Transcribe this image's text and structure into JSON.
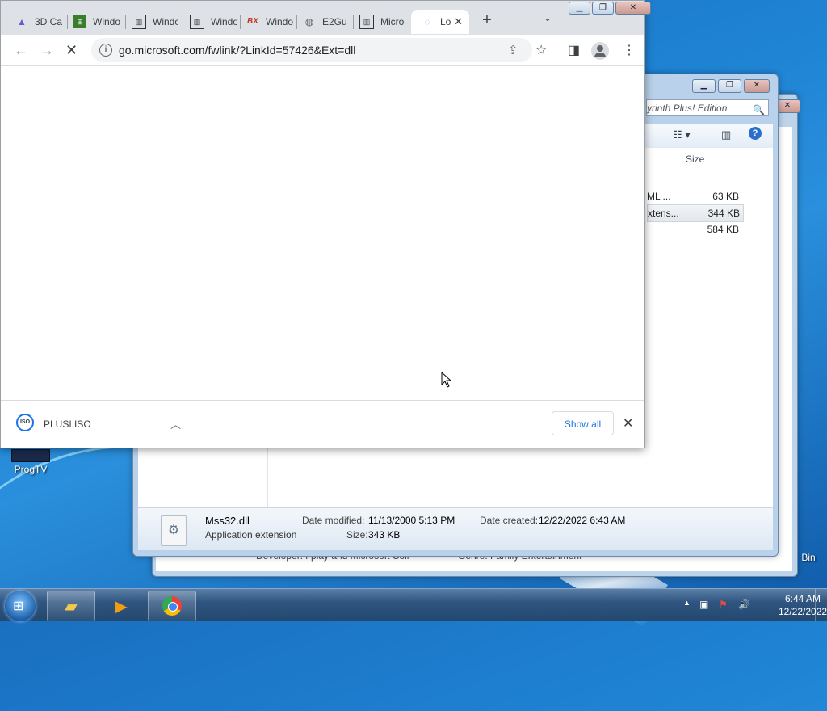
{
  "browser": {
    "tabs": [
      {
        "label": "3D Ca",
        "icon": "triangle-icon"
      },
      {
        "label": "Windo",
        "icon": "windows-flag-icon"
      },
      {
        "label": "Windo",
        "icon": "archive-icon"
      },
      {
        "label": "Windo",
        "icon": "archive-icon"
      },
      {
        "label": "Windo",
        "icon": "bx-icon"
      },
      {
        "label": "E2Gu",
        "icon": "globe-icon"
      },
      {
        "label": "Micro",
        "icon": "archive-icon"
      },
      {
        "label": "Lo",
        "icon": "loading-spinner-icon",
        "active": true
      }
    ],
    "url": "go.microsoft.com/fwlink/?LinkId=57426&Ext=dll",
    "download": {
      "filename": "PLUSI.ISO",
      "icon_text": "ISO"
    },
    "show_all_label": "Show all"
  },
  "explorer": {
    "search_text": "yrinth Plus! Edition",
    "size_header": "Size",
    "rows": [
      {
        "type": "ML ...",
        "size": "63 KB"
      },
      {
        "type": "xtens...",
        "size": "344 KB",
        "selected": true
      },
      {
        "type": "",
        "size": "584 KB"
      }
    ],
    "details": {
      "name": "Mss32.dll",
      "kind": "Application extension",
      "modified_label": "Date modified:",
      "modified": "11/13/2000 5:13 PM",
      "created_label": "Date created:",
      "created": "12/22/2022 6:43 AM",
      "size_label": "Size:",
      "size": "343 KB"
    },
    "back_window_text": {
      "developer": "Developer: i-play and Microsoft Coll",
      "genre": "Genre: Family Entertainment"
    }
  },
  "desktop": {
    "icons": [
      {
        "label": "ProgTV"
      }
    ],
    "bin_label": "Bin"
  },
  "taskbar": {
    "apps": [
      "explorer-folder-icon",
      "media-player-icon",
      "chrome-icon"
    ],
    "time": "6:44 AM",
    "date": "12/22/2022"
  }
}
